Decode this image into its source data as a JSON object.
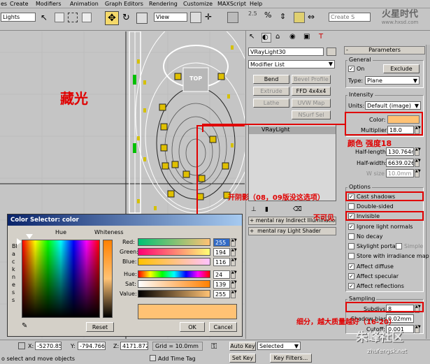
{
  "menu": [
    "es",
    "Create",
    "Modifiers",
    "Animation",
    "Graph Editors",
    "Rendering",
    "Customize",
    "MAXScript",
    "Help"
  ],
  "toolbar": {
    "filter_select": "Lights",
    "view_select": "View",
    "named_selection": "Create S"
  },
  "watermark_top": "火星时代",
  "watermark_top_sub": "www.hxsd.com",
  "watermark_bottom": "朱峰社区",
  "watermark_bottom_sub": "zhufengsk.net",
  "viewport": {
    "top_label": "TOP"
  },
  "modify_panel": {
    "object_name": "VRayLight30",
    "modifier_list": "Modifier List",
    "buttons": [
      "Bend",
      "Bevel Profile",
      "Extrude",
      "FFD 4x4x4",
      "Lathe",
      "UVW Map",
      "NSurf Sel"
    ],
    "stack_item": "VRayLight",
    "rollouts": [
      "mental ray Indirect Illumination",
      "mental ray Light Shader"
    ]
  },
  "params": {
    "title": "Parameters",
    "general": "General",
    "on_label": "On",
    "exclude": "Exclude",
    "type_label": "Type:",
    "type_value": "Plane",
    "intensity": "Intensity",
    "units_label": "Units:",
    "units_value": "Default (image)",
    "color_label": "Color:",
    "multiplier_label": "Multiplier:",
    "multiplier_value": "18.0",
    "half_length_label": "Half-length:",
    "half_length_value": "130.764m",
    "half_width_label": "Half-width:",
    "half_width_value": "6639.026",
    "wsize_label": "W size",
    "wsize_value": "10.0mm",
    "options": "Options",
    "cast_shadows": "Cast shadows",
    "double_sided": "Double-sided",
    "invisible": "Invisible",
    "ignore_normals": "Ignore light normals",
    "no_decay": "No decay",
    "skylight_portal": "Skylight portal",
    "simple": "Simple",
    "store_irradiance": "Store with irradiance map",
    "affect_diffuse": "Affect diffuse",
    "affect_specular": "Affect specular",
    "affect_reflections": "Affect reflections",
    "sampling": "Sampling",
    "subdivs_label": "Subdivs:",
    "subdivs_value": "8",
    "shadow_bias_label": "Shadow bias:",
    "shadow_bias_value": "0.02mm",
    "cutoff_label": "Cutoff:",
    "cutoff_value": "0.001"
  },
  "color_selector": {
    "title": "Color Selector: color",
    "hue_label": "Hue",
    "whiteness_label": "Whiteness",
    "blackness_label": "Blackness",
    "red_label": "Red:",
    "red_value": "255",
    "green_label": "Green:",
    "green_value": "194",
    "blue_label": "Blue:",
    "blue_value": "116",
    "hue2_label": "Hue:",
    "hue2_value": "24",
    "sat_label": "Sat:",
    "sat_value": "139",
    "value_label": "Value:",
    "value_value": "255",
    "reset": "Reset",
    "ok": "OK",
    "cancel": "Cancel",
    "swatch_color": "#ffc274"
  },
  "annotations": {
    "hide_light": "藏光",
    "color_strength": "颜色  强度18",
    "cast_shadow": "开阴影（08，09版没这选项）",
    "invisible": "不可见",
    "subdivs": "细分，越大质量越好（16-20）"
  },
  "status": {
    "x_label": "X:",
    "x_value": "-5270.853r",
    "y_label": "Y:",
    "y_value": "-794.766mi",
    "z_label": "Z:",
    "z_value": "4171.872m",
    "grid": "Grid = 10.0mm",
    "auto_key": "Auto Key",
    "selected": "Selected",
    "set_key": "Set Key",
    "key_filters": "Key Filters...",
    "prompt": "o select and move objects",
    "add_time_tag": "Add Time Tag"
  },
  "colors": {
    "light_color": "#ffc274",
    "accent_red": "#e00000",
    "viewport_bg": "#c5c5c5"
  }
}
